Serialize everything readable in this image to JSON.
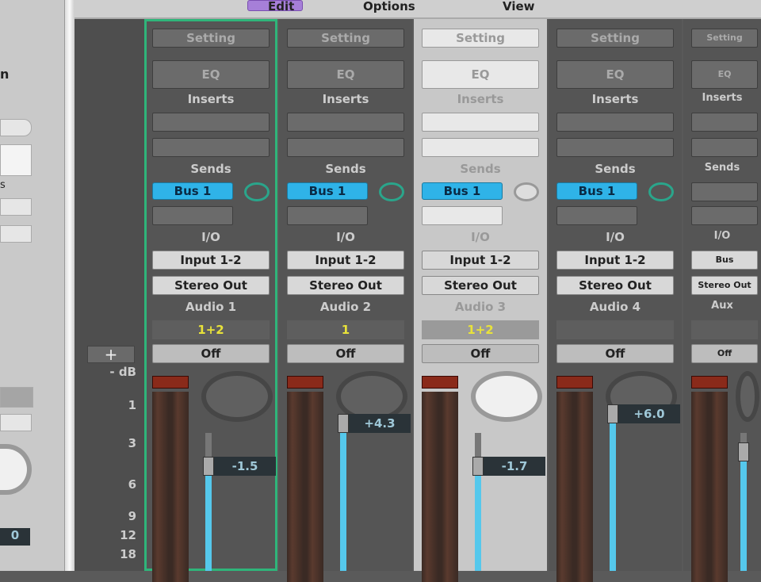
{
  "menu": {
    "edit": "Edit",
    "options": "Options",
    "view": "View"
  },
  "left_panel": {
    "label_1": "n",
    "label_2": "s",
    "value": "0"
  },
  "scale": {
    "add_label": "+",
    "ticks": [
      "- dB",
      "1",
      "3",
      "6",
      "9",
      "12",
      "18"
    ]
  },
  "strips": [
    {
      "setting": "Setting",
      "eq": "EQ",
      "inserts_label": "Inserts",
      "sends_label": "Sends",
      "send": "Bus 1",
      "io_label": "I/O",
      "input": "Input 1-2",
      "output": "Stereo Out",
      "name": "Audio 1",
      "group": "1+2",
      "automation": "Off",
      "volume": "-1.5",
      "fader_level": 0.46,
      "selected": false,
      "highlighted": true
    },
    {
      "setting": "Setting",
      "eq": "EQ",
      "inserts_label": "Inserts",
      "sends_label": "Sends",
      "send": "Bus 1",
      "io_label": "I/O",
      "input": "Input 1-2",
      "output": "Stereo Out",
      "name": "Audio 2",
      "group": "1",
      "automation": "Off",
      "volume": "+4.3",
      "fader_level": 0.64,
      "selected": false,
      "highlighted": false
    },
    {
      "setting": "Setting",
      "eq": "EQ",
      "inserts_label": "Inserts",
      "sends_label": "Sends",
      "send": "Bus 1",
      "io_label": "I/O",
      "input": "Input 1-2",
      "output": "Stereo Out",
      "name": "Audio 3",
      "group": "1+2",
      "automation": "Off",
      "volume": "-1.7",
      "fader_level": 0.46,
      "selected": true,
      "highlighted": false
    },
    {
      "setting": "Setting",
      "eq": "EQ",
      "inserts_label": "Inserts",
      "sends_label": "Sends",
      "send": "Bus 1",
      "io_label": "I/O",
      "input": "Input 1-2",
      "output": "Stereo Out",
      "name": "Audio 4",
      "group": "",
      "automation": "Off",
      "volume": "+6.0",
      "fader_level": 0.68,
      "selected": false,
      "highlighted": false
    },
    {
      "setting": "Setting",
      "eq": "EQ",
      "inserts_label": "Inserts",
      "sends_label": "Sends",
      "send": "",
      "io_label": "I/O",
      "input": "Bus",
      "output": "Stereo Out",
      "name": "Aux",
      "group": "",
      "automation": "Off",
      "volume": "",
      "fader_level": 0.52,
      "selected": false,
      "highlighted": false
    }
  ]
}
